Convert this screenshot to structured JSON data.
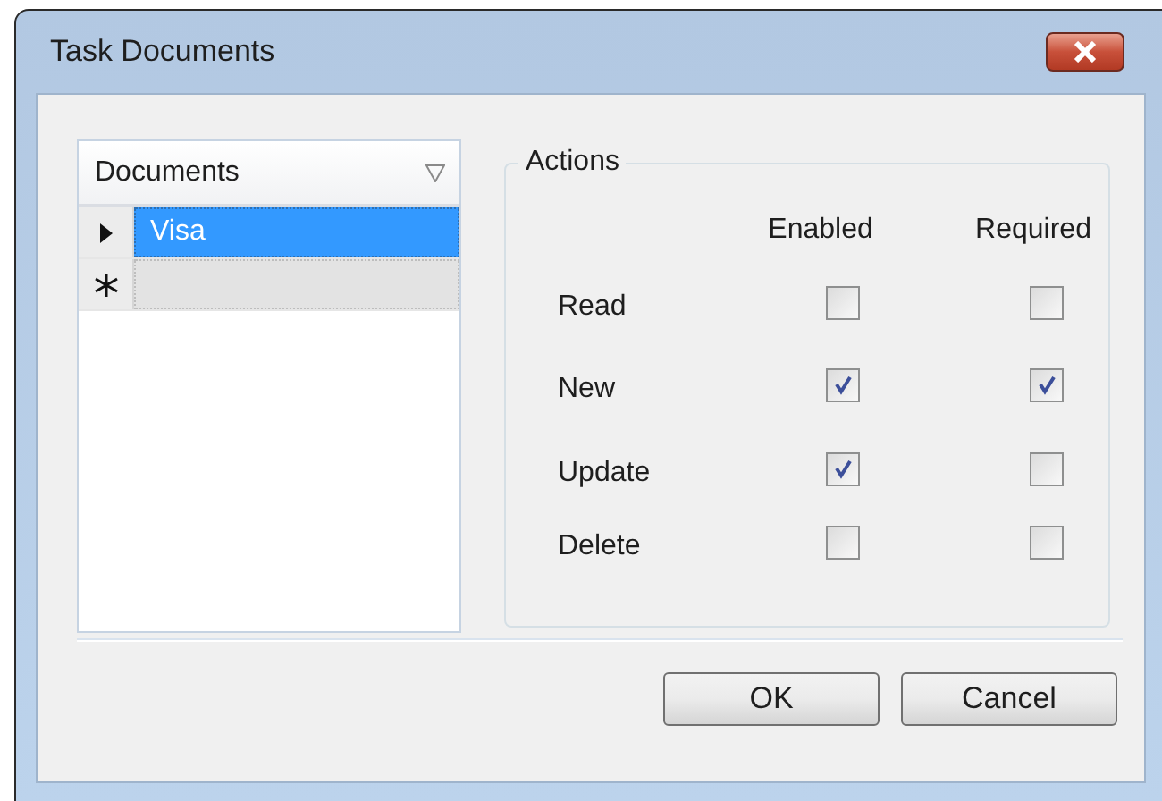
{
  "window": {
    "title": "Task Documents"
  },
  "grid": {
    "column": "Documents",
    "rows": [
      {
        "kind": "current",
        "cell": "Visa",
        "selected": true
      },
      {
        "kind": "new",
        "cell": "",
        "selected": false
      }
    ]
  },
  "actions": {
    "title": "Actions",
    "columns": [
      "Enabled",
      "Required"
    ],
    "rows": [
      {
        "label": "Read",
        "enabled": false,
        "required": false
      },
      {
        "label": "New",
        "enabled": true,
        "required": true
      },
      {
        "label": "Update",
        "enabled": true,
        "required": false
      },
      {
        "label": "Delete",
        "enabled": false,
        "required": false
      }
    ]
  },
  "buttons": [
    "OK",
    "Cancel"
  ]
}
